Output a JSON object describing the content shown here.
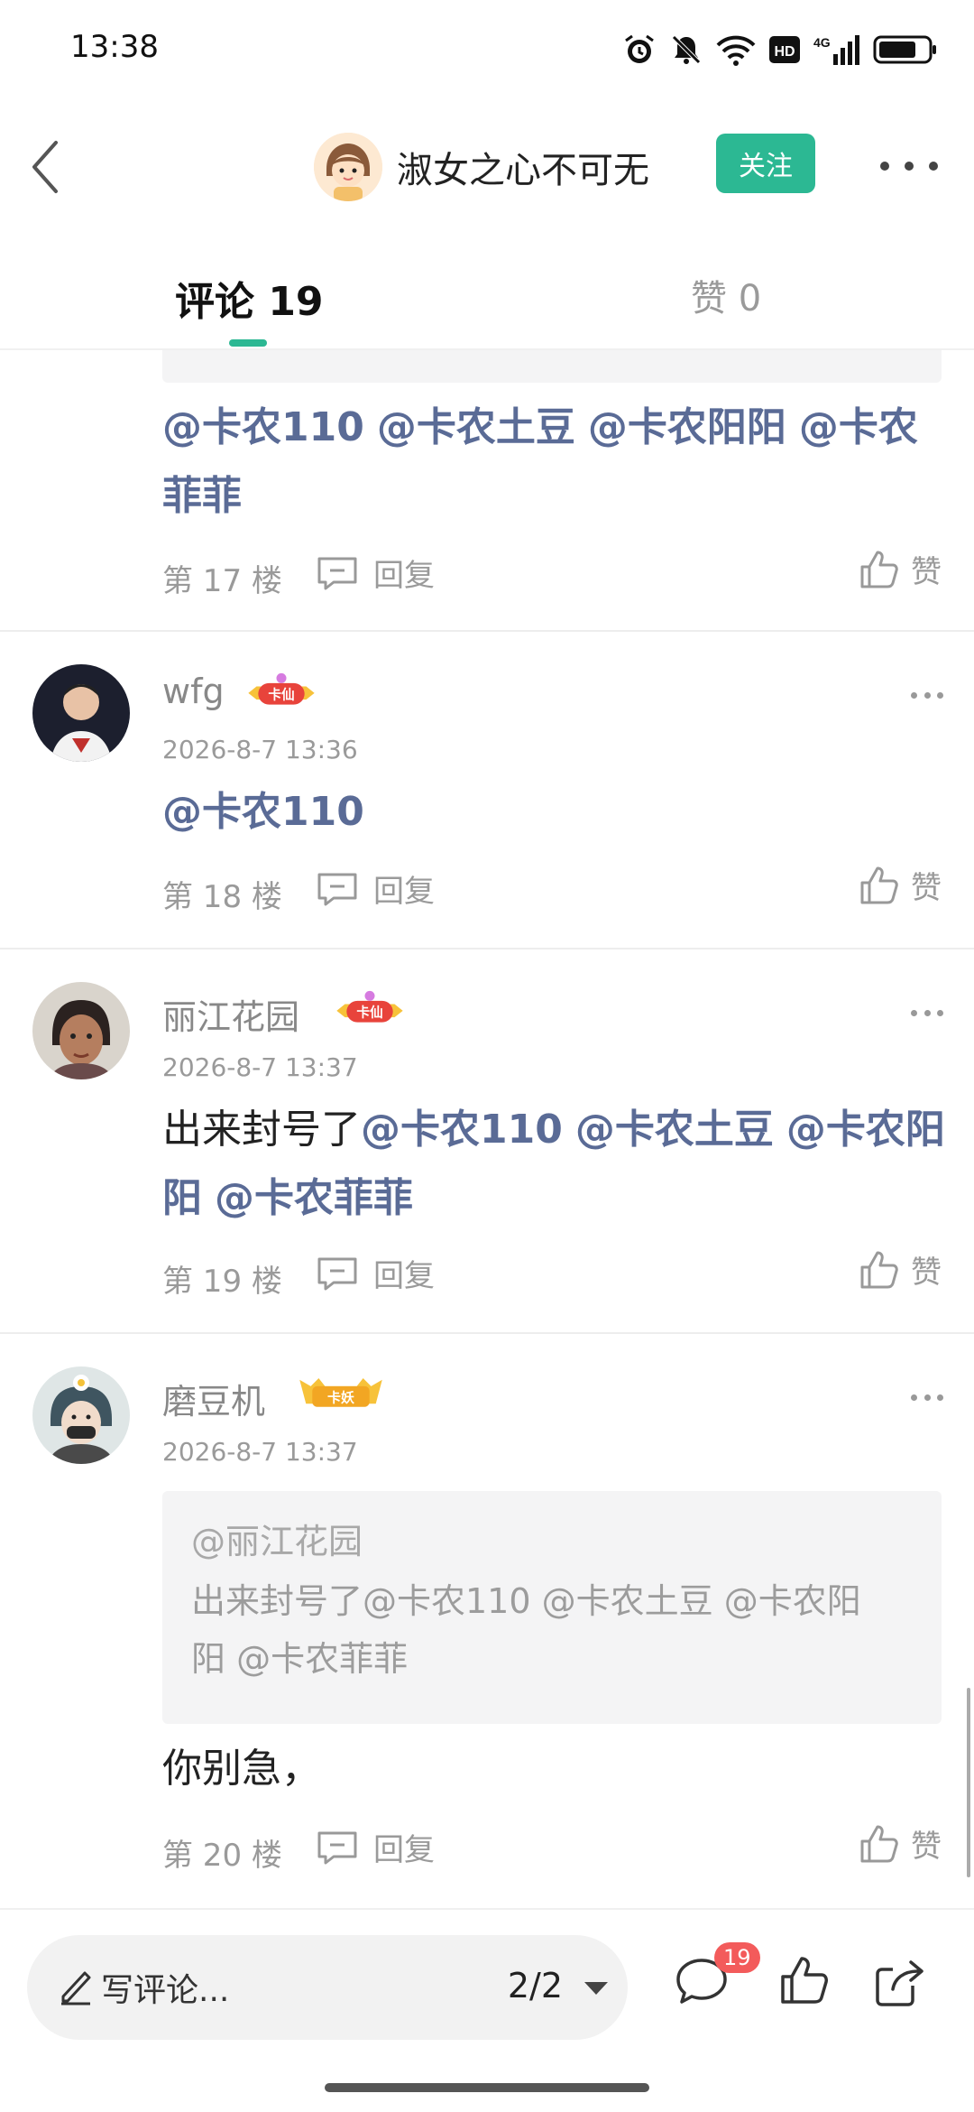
{
  "status_bar": {
    "time": "13:38",
    "hd_label": "HD",
    "net_label": "4G"
  },
  "header": {
    "author_name": "淑女之心不可无",
    "follow_label": "关注"
  },
  "tabs": {
    "comments_label": "评论 19",
    "likes_label": "赞 0"
  },
  "comments": [
    {
      "mentions": [
        "@卡农110",
        "@卡农土豆",
        "@卡农阳阳",
        "@卡农菲菲"
      ],
      "floor": "第 17 楼",
      "reply_label": "回复",
      "like_label": "赞"
    },
    {
      "username": "wfg",
      "badge": "卡仙",
      "time": "2026-8-7 13:36",
      "mentions": [
        "@卡农110"
      ],
      "floor": "第 18 楼",
      "reply_label": "回复",
      "like_label": "赞"
    },
    {
      "username": "丽江花园",
      "badge": "卡仙",
      "time": "2026-8-7 13:37",
      "text_prefix": "出来封号了",
      "mentions": [
        "@卡农110",
        "@卡农土豆",
        "@卡农阳阳",
        "@卡农菲菲"
      ],
      "floor": "第 19 楼",
      "reply_label": "回复",
      "like_label": "赞"
    },
    {
      "username": "磨豆机",
      "badge": "卡妖",
      "time": "2026-8-7 13:37",
      "quote_user": "@丽江花园",
      "quote_line1": "出来封号了@卡农110 @卡农土豆 @卡农阳",
      "quote_line2": "阳 @卡农菲菲",
      "text": "你别急，",
      "floor": "第 20 楼",
      "reply_label": "回复",
      "like_label": "赞"
    }
  ],
  "bottom_bar": {
    "write_placeholder": "写评论...",
    "page_indicator": "2/2",
    "comment_count": "19"
  },
  "colors": {
    "accent": "#2cb893",
    "mention": "#5a6b96",
    "badge_red": "#f35b5b"
  },
  "icons": [
    "back-arrow-icon",
    "more-icon",
    "reply-icon",
    "thumbs-up-icon",
    "pencil-icon",
    "comment-bubble-icon",
    "share-icon",
    "alarm-icon",
    "mute-bell-icon",
    "wifi-icon",
    "signal-icon",
    "battery-icon"
  ]
}
